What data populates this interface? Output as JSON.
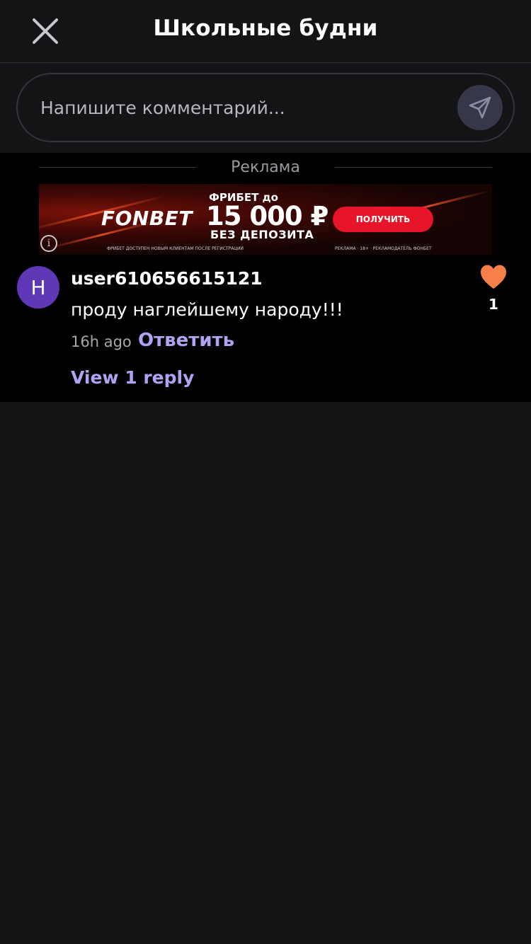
{
  "header": {
    "title": "Школьные будни"
  },
  "comment_input": {
    "placeholder": "Напишите комментарий..."
  },
  "ad": {
    "label": "Реклама",
    "brand": "FONBET",
    "freebet_label": "ФРИБЕТ до",
    "amount": "15 000 ₽",
    "no_deposit": "БЕЗ ДЕПОЗИТА",
    "cta": "ПОЛУЧИТЬ",
    "fine_print_left": "ФРИБЕТ ДОСТУПЕН НОВЫМ КЛИЕНТАМ ПОСЛЕ РЕГИСТРАЦИИ",
    "fine_print_right": "РЕКЛАМА · 18+ · РЕКЛАМОДАТЕЛЬ ФОНБЕТ",
    "info": "i"
  },
  "comment": {
    "avatar_initial": "H",
    "username": "user610656615121",
    "text": "проду наглейшему народу!!!",
    "time": "16h ago",
    "reply_label": "Ответить",
    "view_replies_label": "View 1 reply",
    "likes": "1"
  },
  "colors": {
    "background": "#141316",
    "content_background": "#000000",
    "accent": "#b1a3f2",
    "avatar": "#5e38b7",
    "like": "#f7804a",
    "ad_cta": "#e8152a"
  }
}
